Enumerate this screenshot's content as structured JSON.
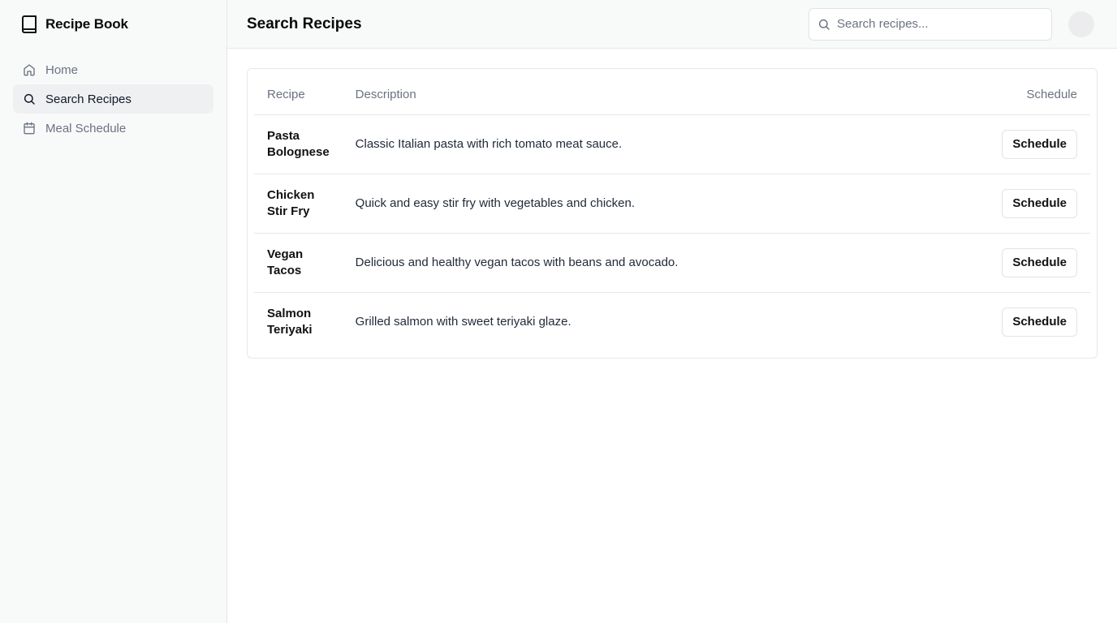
{
  "app": {
    "title": "Recipe Book",
    "brand_icon": "book-icon"
  },
  "sidebar": {
    "items": [
      {
        "label": "Home",
        "icon": "home-icon",
        "active": false
      },
      {
        "label": "Search Recipes",
        "icon": "search-icon",
        "active": true
      },
      {
        "label": "Meal Schedule",
        "icon": "calendar-icon",
        "active": false
      }
    ]
  },
  "header": {
    "title": "Search Recipes",
    "search": {
      "placeholder": "Search recipes...",
      "value": ""
    }
  },
  "table": {
    "columns": [
      "Recipe",
      "Description",
      "Schedule"
    ],
    "rows": [
      {
        "name": "Pasta Bolognese",
        "description": "Classic Italian pasta with rich tomato meat sauce.",
        "action": "Schedule"
      },
      {
        "name": "Chicken Stir Fry",
        "description": "Quick and easy stir fry with vegetables and chicken.",
        "action": "Schedule"
      },
      {
        "name": "Vegan Tacos",
        "description": "Delicious and healthy vegan tacos with beans and avocado.",
        "action": "Schedule"
      },
      {
        "name": "Salmon Teriyaki",
        "description": "Grilled salmon with sweet teriyaki glaze.",
        "action": "Schedule"
      }
    ]
  },
  "colors": {
    "sidebar_bg": "#f8f9f9",
    "active_item_bg": "#eff0f2",
    "border": "#e5e7eb",
    "muted_text": "#6b7280"
  }
}
